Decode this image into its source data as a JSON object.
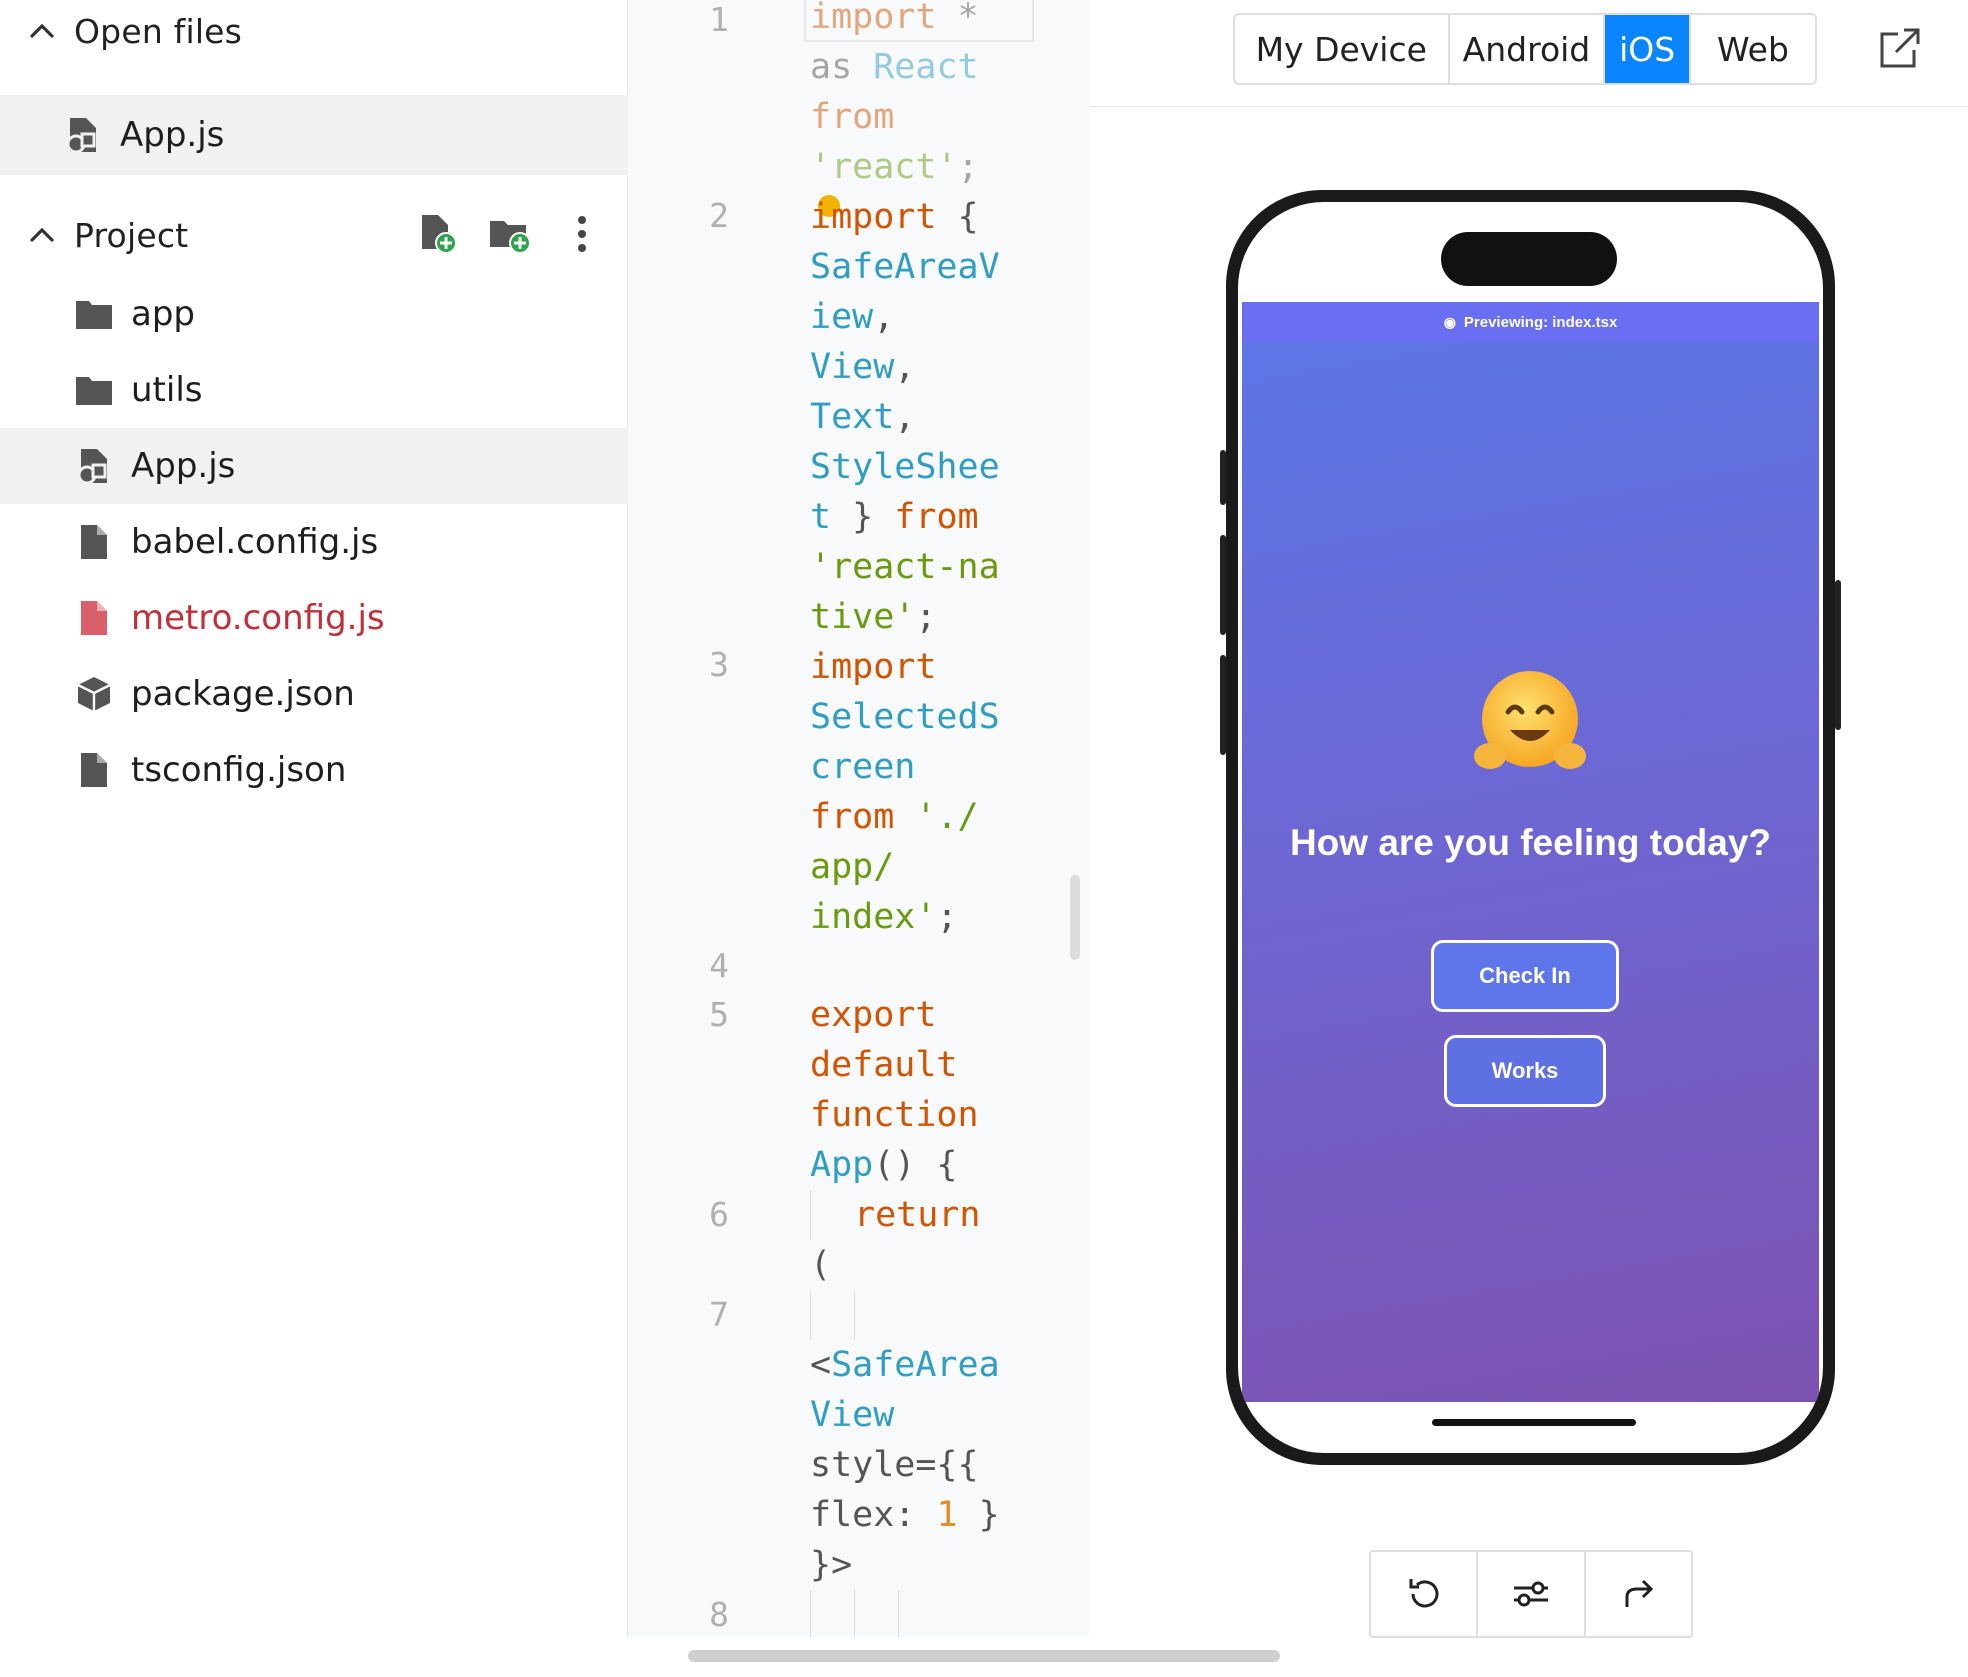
{
  "sidebar": {
    "open_files_title": "Open files",
    "open_files": [
      {
        "name": "App.js",
        "icon": "js-file-icon"
      }
    ],
    "project_title": "Project",
    "items": [
      {
        "name": "app",
        "icon": "folder-icon"
      },
      {
        "name": "utils",
        "icon": "folder-icon"
      },
      {
        "name": "App.js",
        "icon": "js-file-icon",
        "active": true
      },
      {
        "name": "babel.config.js",
        "icon": "file-icon"
      },
      {
        "name": "metro.config.js",
        "icon": "file-icon",
        "error": true
      },
      {
        "name": "package.json",
        "icon": "package-icon"
      },
      {
        "name": "tsconfig.json",
        "icon": "file-icon"
      }
    ]
  },
  "editor": {
    "line_numbers": [
      "1",
      "2",
      "3",
      "4",
      "5",
      "6",
      "7",
      "8"
    ],
    "code": {
      "l1a": "import",
      "l1b": " *",
      "l1c": "as",
      "l1d": " React",
      "l1e": "from",
      "l1f": "'react'",
      "l1g": ";",
      "l2a": "import",
      "l2b": " {",
      "l2c": "SafeAreaV",
      "l2d": "iew",
      "l2e": ",",
      "l2f": "View",
      "l2g": ",",
      "l2h": "Text",
      "l2i": ",",
      "l2j": "StyleShee",
      "l2k": "t",
      "l2l": " } ",
      "l2m": "from",
      "l2n": "'react-na",
      "l2o": "tive'",
      "l2p": ";",
      "l3a": "import",
      "l3b": "SelectedS",
      "l3c": "creen",
      "l3d": "from",
      "l3e": " './",
      "l3f": "app/",
      "l3g": "index'",
      "l3h": ";",
      "l5a": "export",
      "l5b": "default",
      "l5c": "function",
      "l5d": "App",
      "l5e": "() {",
      "l6a": "return",
      "l6b": "(",
      "l7a": "<",
      "l7b": "SafeArea",
      "l7c": "View",
      "l7d": "style={{",
      "l7e": "flex: ",
      "l7f": "1",
      "l7g": " }",
      "l7h": "}>"
    }
  },
  "preview": {
    "tabs": [
      "My Device",
      "Android",
      "iOS",
      "Web"
    ],
    "selected_tab": "iOS",
    "preview_bar": "Previewing: index.tsx",
    "heading": "How are you feeling today?",
    "emoji": "hugging-face",
    "buttons": {
      "check_in": "Check In",
      "works": "Works"
    },
    "accent": "#0a84ff"
  }
}
